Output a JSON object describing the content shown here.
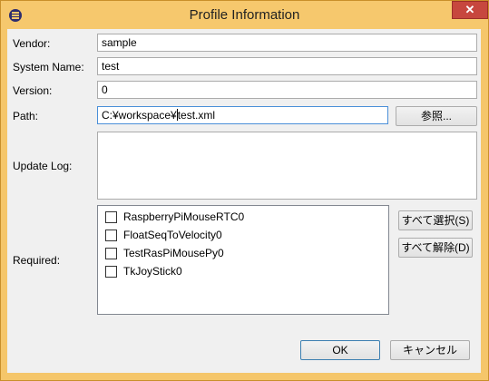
{
  "window": {
    "title": "Profile Information",
    "close_glyph": "✕"
  },
  "form": {
    "vendor_label": "Vendor:",
    "vendor_value": "sample",
    "system_name_label": "System Name:",
    "system_name_value": "test",
    "version_label": "Version:",
    "version_value": "0",
    "path_label": "Path:",
    "path_value_before_caret": "C:¥workspace¥",
    "path_value_after_caret": "test.xml",
    "browse_button": "参照...",
    "update_log_label": "Update Log:",
    "update_log_value": "",
    "required_label": "Required:",
    "required_items": [
      {
        "label": "RaspberryPiMouseRTC0",
        "checked": false
      },
      {
        "label": "FloatSeqToVelocity0",
        "checked": false
      },
      {
        "label": "TestRasPiMousePy0",
        "checked": false
      },
      {
        "label": "TkJoyStick0",
        "checked": false
      }
    ],
    "select_all_button": "すべて選択(S)",
    "deselect_all_button": "すべて解除(D)"
  },
  "footer": {
    "ok_button": "OK",
    "cancel_button": "キャンセル"
  },
  "colors": {
    "titlebar": "#f6c86d",
    "close": "#c7473e",
    "client_bg": "#f0f0f0"
  }
}
